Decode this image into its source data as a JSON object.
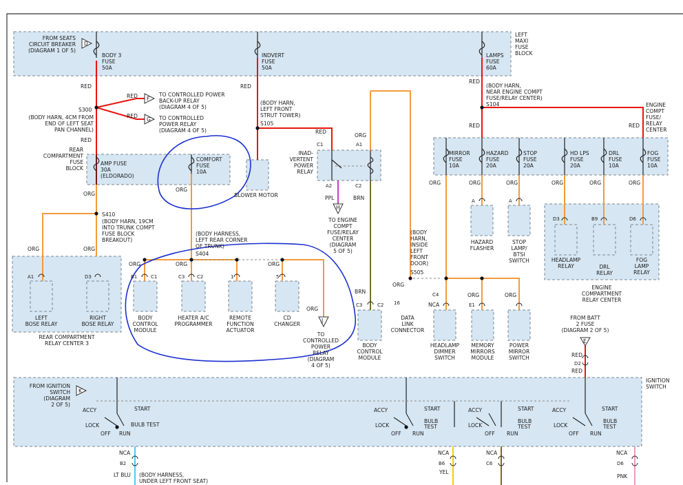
{
  "diagram": {
    "blocks": {
      "left_maxi_fuse_block": [
        "LEFT",
        "MAXI",
        "FUSE",
        "BLOCK"
      ],
      "rear_compartment_fuse_block": [
        "REAR",
        "COMPARTMENT",
        "FUSE",
        "BLOCK"
      ],
      "rear_compartment_relay_center": [
        "REAR COMPARTMENT",
        "RELAY CENTER 3"
      ],
      "engine_compartment_relay_center": [
        "ENGINE",
        "COMPARTMENT",
        "RELAY CENTER"
      ],
      "engine_compt_fuse_relay_center": [
        "ENGINE",
        "COMPT",
        "FUSE/",
        "RELAY",
        "CENTER"
      ],
      "ignition_switch": [
        "IGNITION",
        "SWITCH"
      ]
    },
    "fuses": {
      "body": [
        "BODY 3",
        "FUSE",
        "50A"
      ],
      "indvert": [
        "INDVERT",
        "FUSE",
        "50A"
      ],
      "lamps": [
        "LAMPS",
        "FUSE",
        "60A"
      ],
      "amp": [
        "AMP FUSE",
        "30A",
        "(ELDORADO)"
      ],
      "comfort": [
        "COMFORT",
        "FUSE",
        "10A"
      ],
      "mirror": [
        "MIRROR",
        "FUSE",
        "10A"
      ],
      "hazard": [
        "HAZARD",
        "FUSE",
        "20A"
      ],
      "stop": [
        "STOP",
        "FUSE",
        "20A"
      ],
      "hdlps": [
        "HD LPS",
        "FUSE",
        "20A"
      ],
      "drl": [
        "DRL",
        "FUSE",
        "10A"
      ],
      "fog": [
        "FOG",
        "FUSE",
        "10A"
      ]
    },
    "connectors": {
      "D": "D",
      "F": "F",
      "G": "G",
      "H": "H",
      "J": "J",
      "E": "E",
      "K": "K"
    },
    "labels": {
      "from_seats": [
        "FROM SEATS",
        "CIRCUIT BREAKER",
        "(DIAGRAM 1 OF 5)"
      ],
      "ctrl_power_backup": [
        "TO CONTROLLED POWER",
        "BACK-UP RELAY",
        "(DIAGRAM 4 OF 5)"
      ],
      "ctrl_power_relay_g": [
        "TO CONTROLLED",
        "POWER RELAY",
        "(DIAGRAM 4 OF 5)"
      ],
      "s300": "S300",
      "s300_desc": [
        "(BODY HARN, 4CM FROM",
        "END OF LEFT SEAT",
        "PAN CHANNEL)"
      ],
      "s105_desc": [
        "(BODY HARN,",
        "LEFT FRONT",
        "STRUT TOWER)"
      ],
      "s105": "S105",
      "s104_desc": [
        "(BODY HARN,",
        "NEAR ENGINE COMPT",
        "FUSE/RELAY CENTER)"
      ],
      "s104": "S104",
      "s410": "S410",
      "s410_desc": [
        "(BODY HARN, 19CM",
        "INTO TRUNK COMPT",
        "FUSE BLOCK",
        "BREAKOUT)"
      ],
      "s404_desc": [
        "(BODY HARNESS,",
        "LEFT REAR CORNER",
        "OF TRUNK)"
      ],
      "s404": "S404",
      "s505_desc": [
        "(BODY",
        "HARN,",
        "INSIDE",
        "LEFT",
        "FRONT",
        "DOOR)"
      ],
      "s505": "S505",
      "blower_motor": "BLOWER MOTOR",
      "inadvertent_relay": [
        "INAD-",
        "VERTENT",
        "POWER",
        "RELAY"
      ],
      "to_engine_compt": [
        "TO ENGINE",
        "COMPT",
        "FUSE/RELAY",
        "CENTER",
        "(DIAGRAM",
        "5 OF 5)"
      ],
      "to_ctrl_power_j": [
        "TO",
        "CONTROLLED",
        "POWER",
        "RELAY",
        "(DIAGRAM",
        "4 OF 5)"
      ],
      "from_batt": [
        "FROM BATT",
        "2 FUSE",
        "(DIAGRAM 2 OF 5)"
      ],
      "from_ignition": [
        "FROM IGNITION",
        "SWITCH",
        "(DIAGRAM",
        "2 OF 5)"
      ],
      "body_harness_bottom": [
        "(BODY HARNESS,",
        "UNDER LEFT FRONT SEAT)"
      ]
    },
    "components": {
      "left_bose": [
        "LEFT",
        "BOSE RELAY"
      ],
      "right_bose": [
        "RIGHT",
        "BOSE RELAY"
      ],
      "bcm_b1": [
        "BODY",
        "CONTROL",
        "MODULE"
      ],
      "heater_ac": [
        "HEATER A/C",
        "PROGRAMMER"
      ],
      "remote_func": [
        "REMOTE",
        "FUNCTION",
        "ACTUATOR"
      ],
      "cd_changer": [
        "CD",
        "CHANGER"
      ],
      "bcm_c3": [
        "BODY",
        "CONTROL",
        "MODULE"
      ],
      "data_link": [
        "DATA",
        "LINK",
        "CONNECTOR"
      ],
      "headlamp_dimmer": [
        "HEADLAMP",
        "DIMMER",
        "SWITCH"
      ],
      "memory_mirrors": [
        "MEMORY",
        "MIRRORS",
        "MODULE"
      ],
      "power_mirror": [
        "POWER",
        "MIRROR",
        "SWITCH"
      ],
      "hazard_flasher": [
        "HAZARD",
        "FLASHER"
      ],
      "stop_lamp": [
        "STOP",
        "LAMP/",
        "BTSI",
        "SWITCH"
      ],
      "headlamp_relay": [
        "HEADLAMP",
        "RELAY"
      ],
      "drl_relay": [
        "DRL",
        "RELAY"
      ],
      "fog_relay": [
        "FOG",
        "LAMP",
        "RELAY"
      ]
    },
    "pins": {
      "c1": "C1",
      "a1": "A1",
      "a2": "A2",
      "c2": "C2",
      "a1b": "A1",
      "d3b": "D3",
      "b1": "B1",
      "c1b": "C1",
      "c3": "C3",
      "c2b": "C2",
      "p1": "1",
      "p5": "5",
      "c3b": "C3",
      "c2c": "C2",
      "p16": "16",
      "c4": "C4",
      "e1": "E1",
      "a_hz": "A",
      "a_st": "A",
      "d3": "D3",
      "b9": "B9",
      "d6": "D6",
      "d2": "D2",
      "b2": "B2",
      "b6": "B6",
      "c6": "C6",
      "d6b": "D6"
    },
    "wires": {
      "red": "RED",
      "org": "ORG",
      "ppl": "PPL",
      "brn": "BRN",
      "nca": "NCA",
      "lt_blu": "LT BLU",
      "yel": "YEL",
      "pnk": "PNK"
    },
    "switch_terms": {
      "accy": "ACCY",
      "start": "START",
      "lock": "LOCK",
      "bulb_test": "BULB TEST",
      "bulb": "BULB",
      "test": "TEST",
      "off": "OFF",
      "run": "RUN"
    },
    "colors": {
      "red_wire": "#e8140e",
      "orange_wire": "#f29a3c",
      "purple_wire": "#c43cc8",
      "brown_wire": "#7a6a2a",
      "yellow_wire": "#f0d400",
      "blue_wire": "#4fc8f0",
      "pink_wire": "#f19abf",
      "box_fill": "#d6e6f2",
      "annotation": "#1a2fd0"
    }
  }
}
